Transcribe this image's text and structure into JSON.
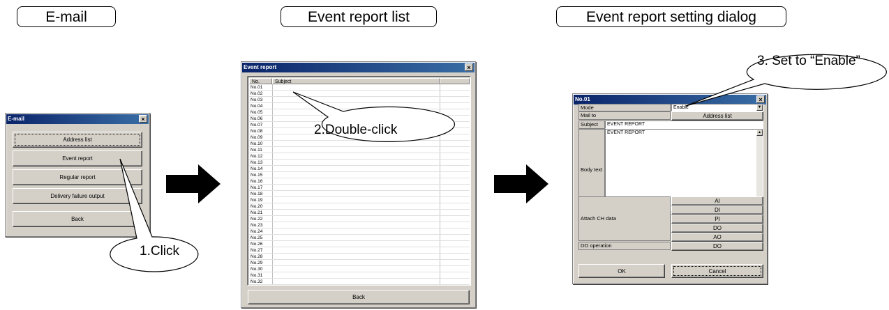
{
  "headings": {
    "email": "E-mail",
    "event_list": "Event report list",
    "event_dialog": "Event report setting dialog"
  },
  "email_window": {
    "title": "E-mail",
    "close": "×",
    "buttons": [
      "Address list",
      "Event report",
      "Regular report",
      "Delivery failure output",
      "Back"
    ]
  },
  "event_window": {
    "title": "Event report",
    "close": "×",
    "columns": [
      "No.",
      "Subject"
    ],
    "rows": [
      "No.01",
      "No.02",
      "No.03",
      "No.04",
      "No.05",
      "No.06",
      "No.07",
      "No.08",
      "No.09",
      "No.10",
      "No.11",
      "No.12",
      "No.13",
      "No.14",
      "No.15",
      "No.16",
      "No.17",
      "No.18",
      "No.19",
      "No.20",
      "No.21",
      "No.22",
      "No.23",
      "No.24",
      "No.25",
      "No.26",
      "No.27",
      "No.28",
      "No.29",
      "No.30",
      "No.31",
      "No.32"
    ],
    "back": "Back"
  },
  "dialog": {
    "title": "No.01",
    "close": "×",
    "mode_label": "Mode",
    "mode_value": "Enable",
    "mail_to_label": "Mail to",
    "address_list": "Address list",
    "subject_label": "Subject",
    "subject_value": "EVENT REPORT",
    "body_label": "Body text",
    "body_value": "EVENT REPORT",
    "attach_label": "Attach CH data",
    "attach_buttons": [
      "AI",
      "DI",
      "PI",
      "DO",
      "AO"
    ],
    "do_label": "DO operation",
    "do_button": "DO",
    "ok": "OK",
    "cancel": "Cancel"
  },
  "callouts": {
    "click": "1.Click",
    "double_click": "2.Double-click",
    "enable": "3. Set to “Enable”"
  }
}
